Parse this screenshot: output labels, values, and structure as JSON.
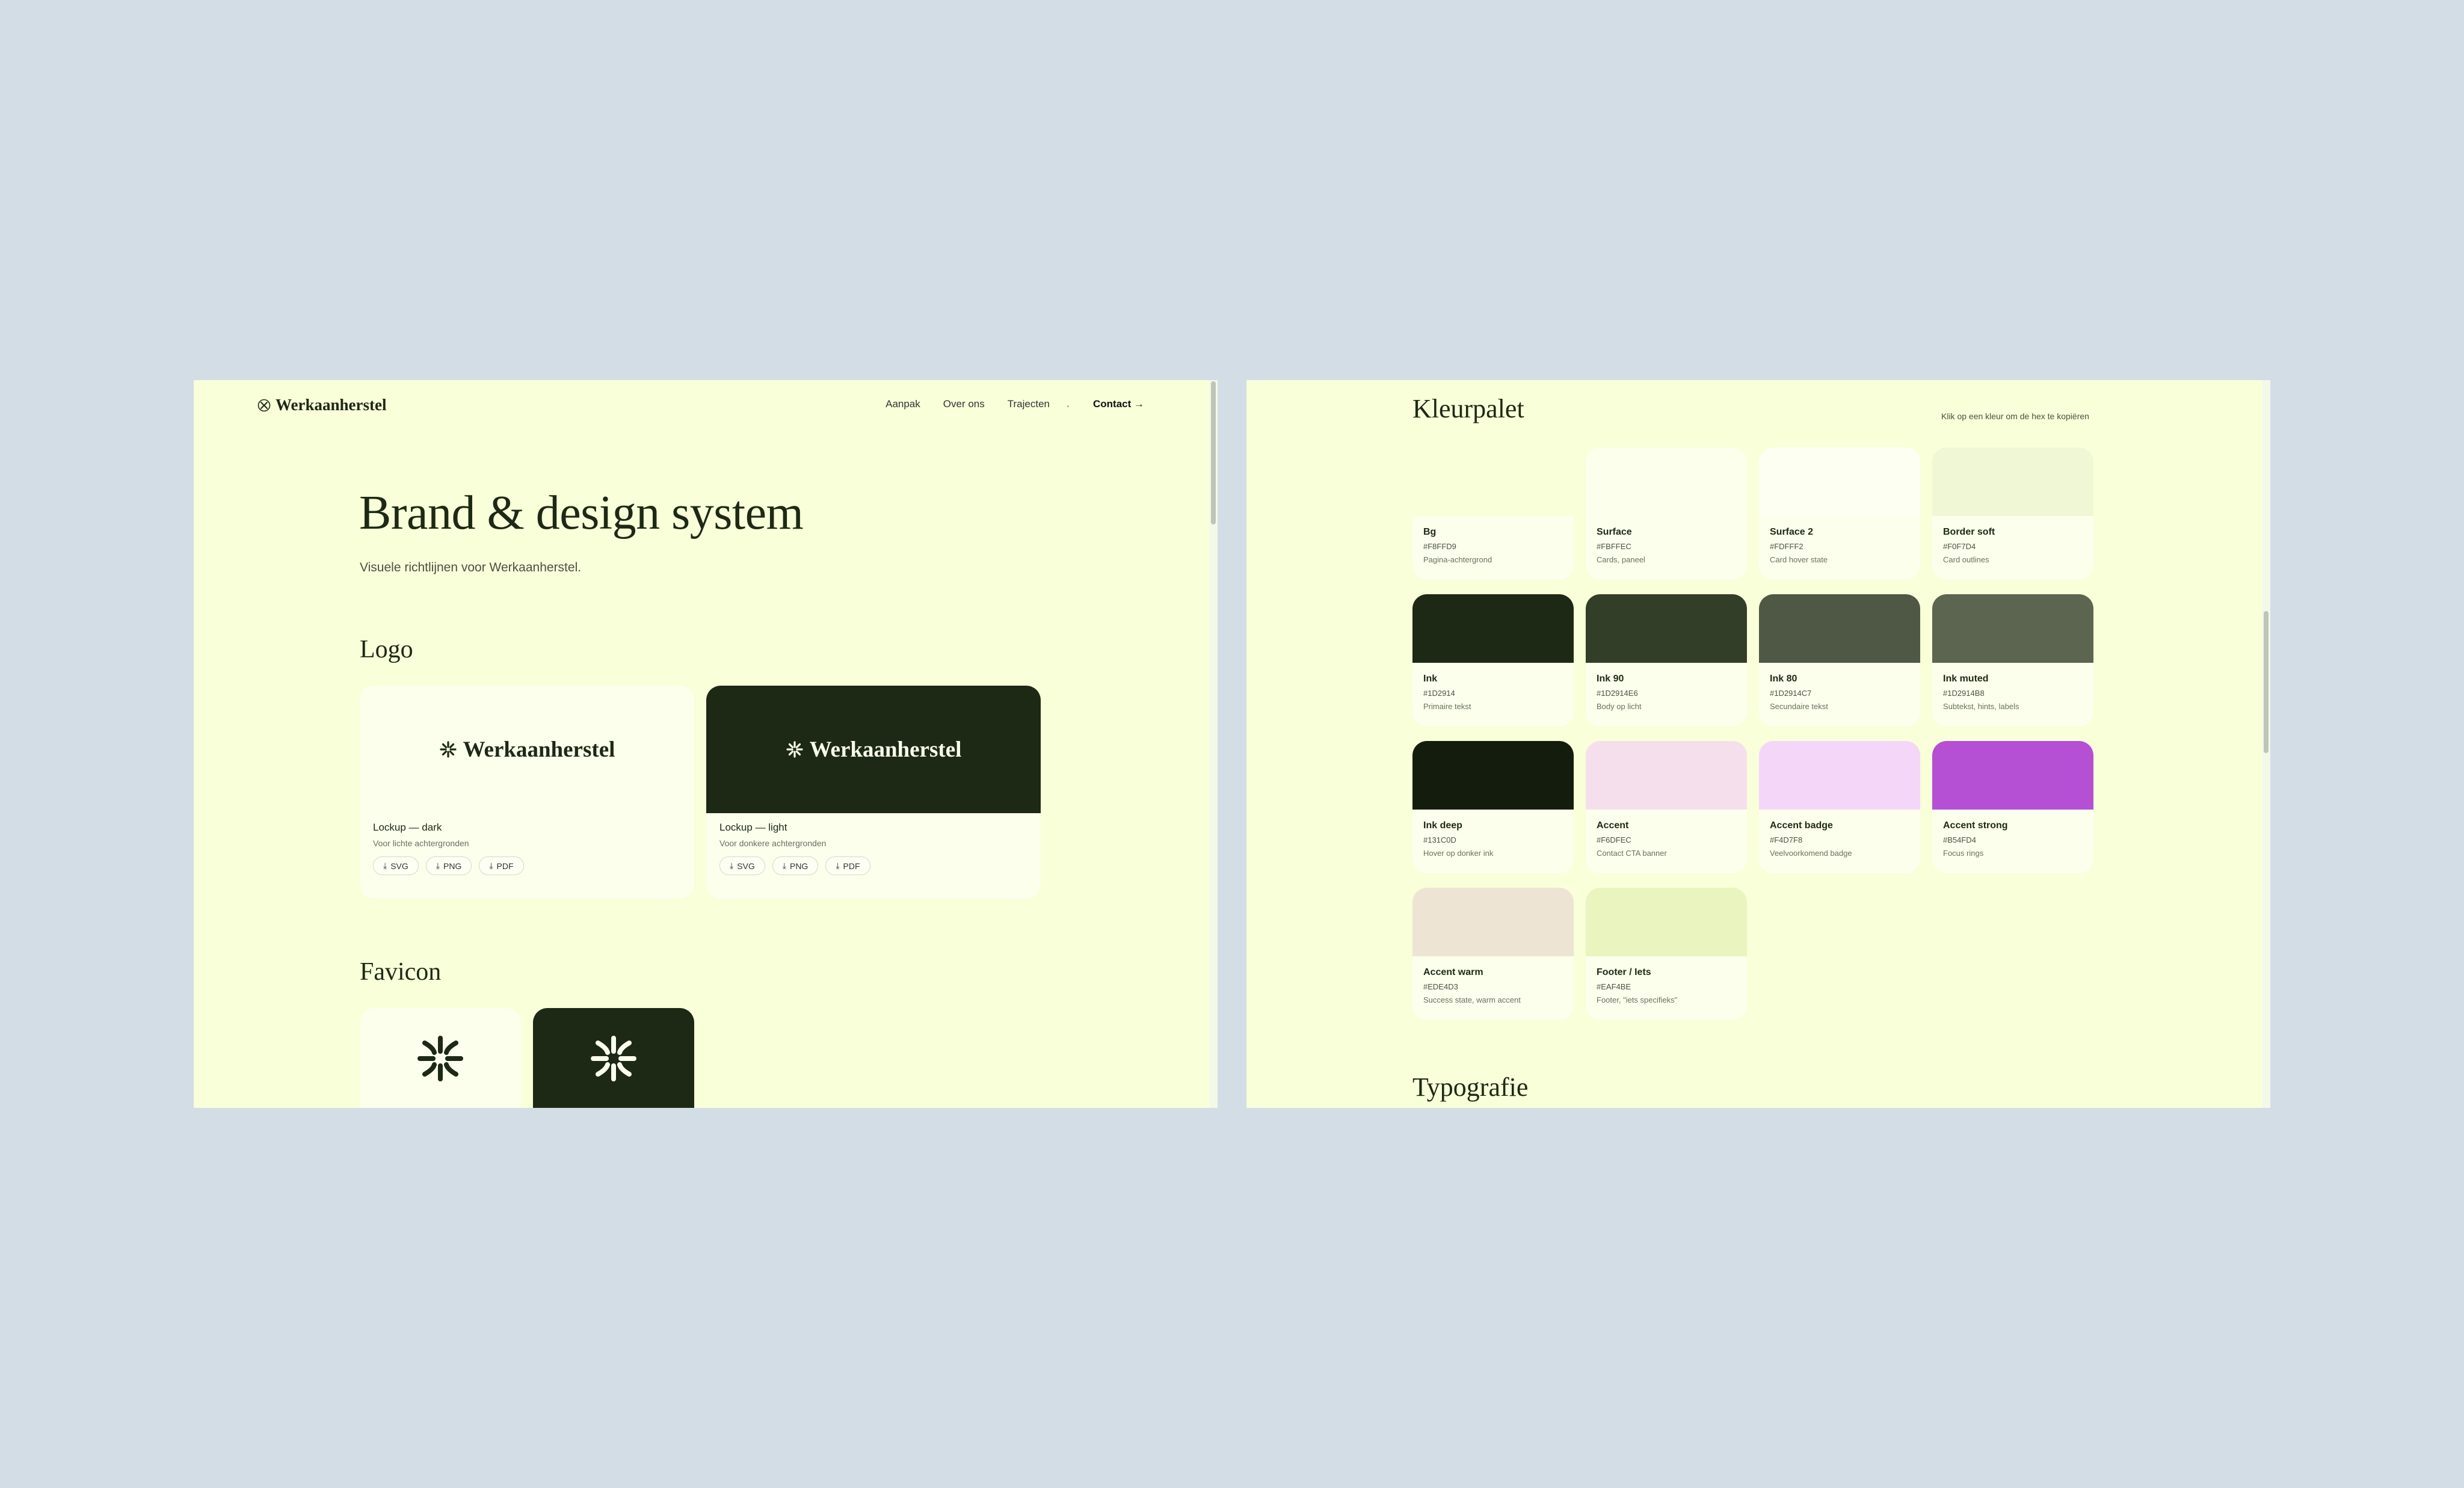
{
  "brand": {
    "name": "Werkaanherstel"
  },
  "nav": {
    "links": [
      "Aanpak",
      "Over ons",
      "Trajecten"
    ],
    "contact": "Contact →"
  },
  "hero": {
    "title": "Brand & design system",
    "subtitle": "Visuele richtlijnen voor Werkaanherstel."
  },
  "logo_section": {
    "title": "Logo",
    "cards": [
      {
        "title": "Lockup — dark",
        "desc": "Voor lichte achtergronden",
        "wordmark": "Werkaanherstel",
        "bg": "#FBFFEC",
        "fg": "#1D2914"
      },
      {
        "title": "Lockup — light",
        "desc": "Voor donkere achtergronden",
        "wordmark": "Werkaanherstel",
        "bg": "#1D2914",
        "fg": "#FBFFEC"
      }
    ],
    "downloads": [
      "SVG",
      "PNG",
      "PDF"
    ]
  },
  "favicon_section": {
    "title": "Favicon",
    "icons": [
      {
        "name": "asterisk-mark-icon",
        "bg": "#FBFFEC",
        "fg": "#1D2914"
      },
      {
        "name": "asterisk-mark-icon",
        "bg": "#1D2914",
        "fg": "#FBFFEC"
      }
    ]
  },
  "palette": {
    "title": "Kleurpalet",
    "hint": "Klik op een kleur om de hex te kopiëren",
    "colors": [
      {
        "name": "Bg",
        "hex": "#F8FFD9",
        "desc": "Pagina-achtergrond"
      },
      {
        "name": "Surface",
        "hex": "#FBFFEC",
        "desc": "Cards, paneel"
      },
      {
        "name": "Surface 2",
        "hex": "#FDFFF2",
        "desc": "Card hover state"
      },
      {
        "name": "Border soft",
        "hex": "#F0F7D4",
        "desc": "Card outlines"
      },
      {
        "name": "Ink",
        "hex": "#1D2914",
        "desc": "Primaire tekst"
      },
      {
        "name": "Ink 90",
        "hex": "#1D2914E6",
        "desc": "Body op licht"
      },
      {
        "name": "Ink 80",
        "hex": "#1D2914C7",
        "desc": "Secundaire tekst"
      },
      {
        "name": "Ink muted",
        "hex": "#1D2914B8",
        "desc": "Subtekst, hints, labels"
      },
      {
        "name": "Ink deep",
        "hex": "#131C0D",
        "desc": "Hover op donker ink"
      },
      {
        "name": "Accent",
        "hex": "#F6DFEC",
        "desc": "Contact CTA banner"
      },
      {
        "name": "Accent badge",
        "hex": "#F4D7F8",
        "desc": "Veelvoorkomend badge"
      },
      {
        "name": "Accent strong",
        "hex": "#B54FD4",
        "desc": "Focus rings"
      },
      {
        "name": "Accent warm",
        "hex": "#EDE4D3",
        "desc": "Success state, warm accent"
      },
      {
        "name": "Footer / Iets",
        "hex": "#EAF4BE",
        "desc": "Footer, \"iets specifieks\""
      }
    ]
  },
  "typography": {
    "title": "Typografie"
  }
}
